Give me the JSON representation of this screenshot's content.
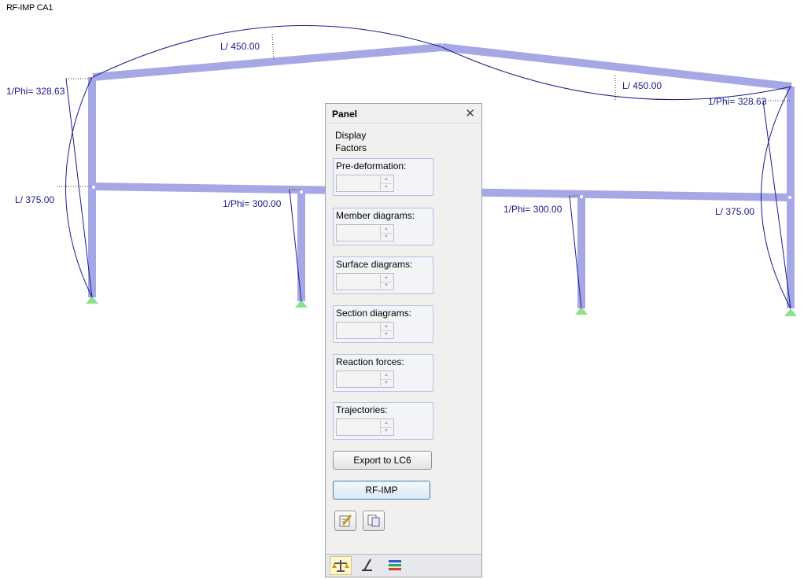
{
  "canvas": {
    "title": "RF-IMP CA1",
    "labels": {
      "left_rafter": "L/ 450.00",
      "right_rafter": "L/ 450.00",
      "left_phi": "1/Phi= 328.63",
      "right_phi": "1/Phi= 328.63",
      "left_column": "L/ 375.00",
      "right_column": "L/ 375.00",
      "inner_left_phi": "1/Phi= 300.00",
      "inner_right_phi": "1/Phi= 300.00"
    }
  },
  "panel": {
    "title": "Panel",
    "close_icon": "close-icon",
    "display_label": "Display",
    "factors_label": "Factors",
    "groups": [
      {
        "label": "Pre-deformation:",
        "value": ""
      },
      {
        "label": "Member diagrams:",
        "value": ""
      },
      {
        "label": "Surface diagrams:",
        "value": ""
      },
      {
        "label": "Section diagrams:",
        "value": ""
      },
      {
        "label": "Reaction forces:",
        "value": ""
      },
      {
        "label": "Trajectories:",
        "value": ""
      }
    ],
    "export_button": "Export to LC6",
    "module_button": "RF-IMP",
    "icon_buttons": [
      "edit-icon",
      "copy-icon"
    ],
    "tabs": [
      "scale-icon",
      "pointer-icon",
      "color-bars-icon"
    ]
  }
}
